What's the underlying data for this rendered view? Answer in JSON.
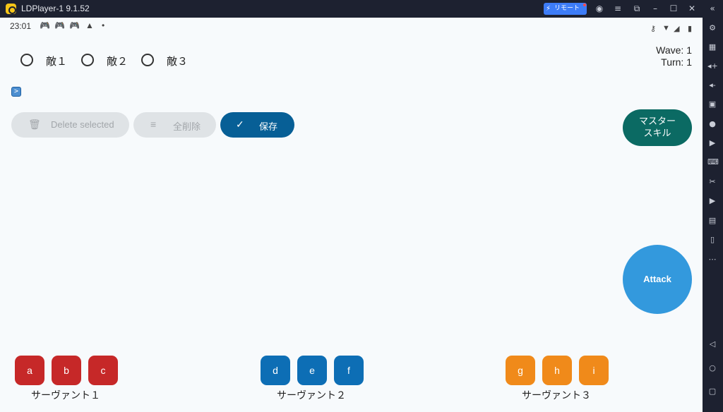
{
  "window": {
    "title": "LDPlayer-1 9.1.52",
    "remote_label": "リモート",
    "controls": [
      "account-icon",
      "menu-icon",
      "restore-icon",
      "minimize-icon",
      "maximize-icon",
      "close-icon",
      "collapse-icon"
    ]
  },
  "statusbar": {
    "time": "23:01",
    "left_icons": [
      "gamepad-icon",
      "gamepad-icon",
      "gamepad-icon",
      "a-badge-icon",
      "dot-icon"
    ],
    "right_icons": [
      "vpn-key-icon",
      "wifi-icon",
      "signal-icon",
      "battery-icon"
    ]
  },
  "enemies": [
    {
      "label": "敵１",
      "selected": false
    },
    {
      "label": "敵２",
      "selected": false
    },
    {
      "label": "敵３",
      "selected": false
    }
  ],
  "battle": {
    "wave": "Wave: 1",
    "turn": "Turn: 1"
  },
  "expand_label": ">",
  "actions": {
    "delete_selected": "Delete selected",
    "delete_all": "全削除",
    "save": "保存",
    "master_skill_line1": "マスター",
    "master_skill_line2": "スキル",
    "attack": "Attack"
  },
  "servants": [
    {
      "label": "サーヴァント１",
      "skills": [
        "a",
        "b",
        "c"
      ],
      "color": "#c62828"
    },
    {
      "label": "サーヴァント２",
      "skills": [
        "d",
        "e",
        "f"
      ],
      "color": "#0d6eb5"
    },
    {
      "label": "サーヴァント３",
      "skills": [
        "g",
        "h",
        "i"
      ],
      "color": "#f08a1a"
    }
  ],
  "colors": {
    "save_button": "#075f96",
    "master_skill_button": "#0b6a63",
    "attack_button": "#3399dd",
    "disabled_button": "#dfe3e6"
  },
  "sidebar_icons": [
    "settings-icon",
    "keyboard-map-icon",
    "volume-up-icon",
    "volume-down-icon",
    "screenshot-icon",
    "location-icon",
    "record-icon",
    "keyboard-icon",
    "scissors-icon",
    "video-icon",
    "apk-icon",
    "phone-icon",
    "more-icon",
    "back-icon",
    "home-icon",
    "recents-icon"
  ]
}
